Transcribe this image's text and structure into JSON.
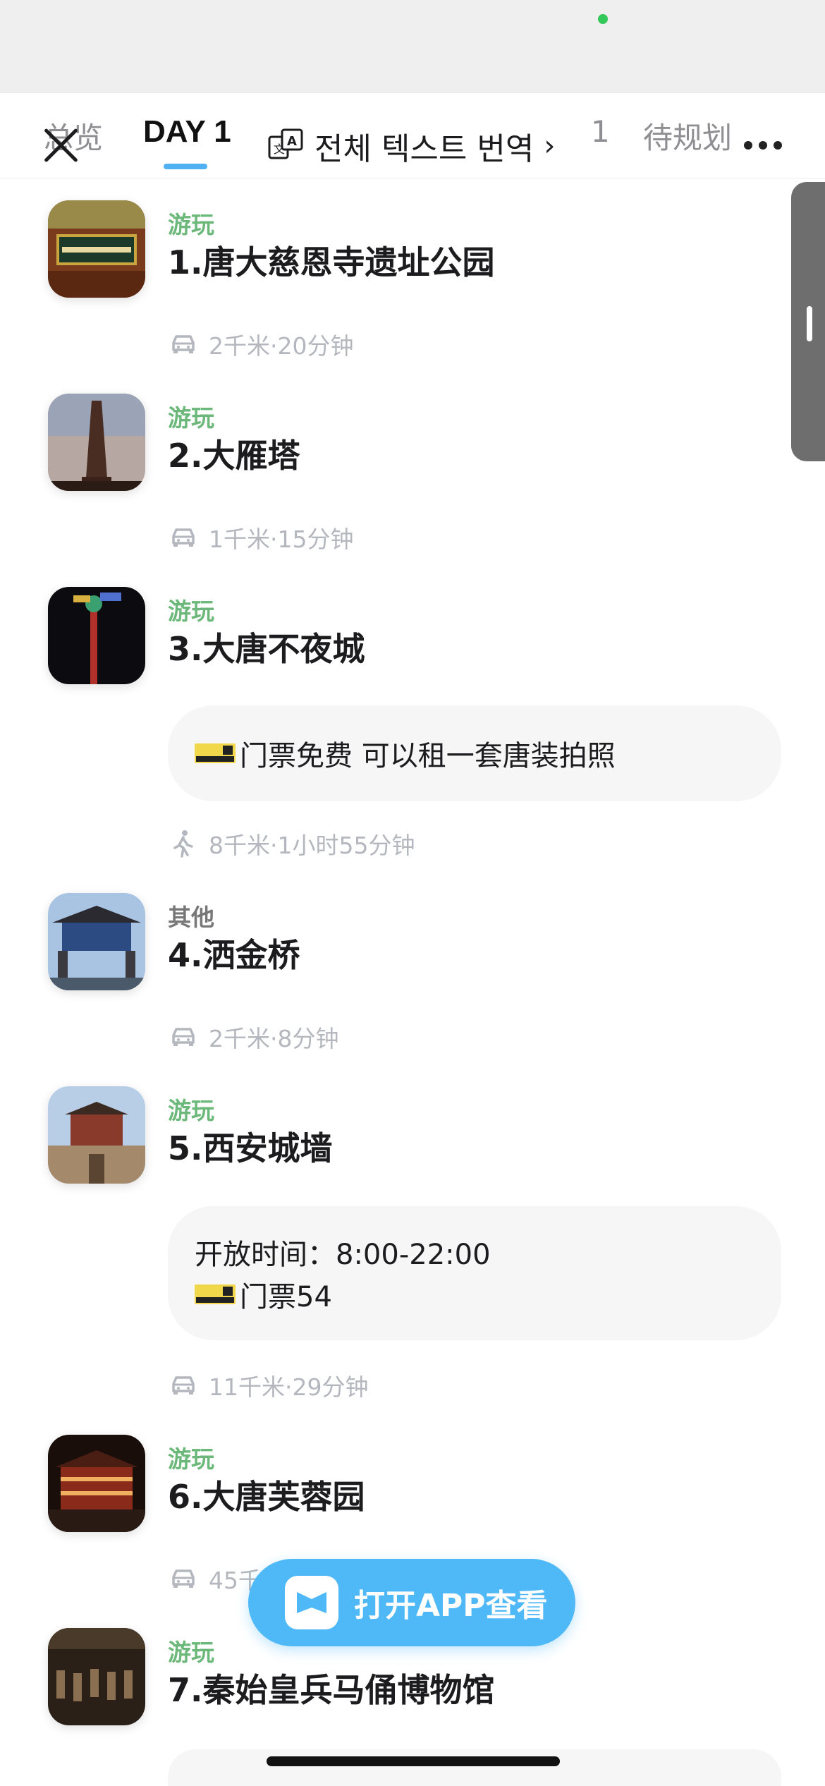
{
  "colors": {
    "accent": "#4fb0f2",
    "category_play": "#6cb87a",
    "transit_text": "#b4b8be",
    "open_app_bg": "#4fb8f7"
  },
  "tabs": {
    "overview": "总览",
    "day1": "DAY 1",
    "partial": "1",
    "todo": "待规划"
  },
  "translate": {
    "label": "전체 텍스트 번역",
    "chevron": "›"
  },
  "itinerary": [
    {
      "category": "游玩",
      "name": "1.唐大慈恩寺遗址公园",
      "icon": "landmark-photo"
    },
    {
      "category": "游玩",
      "name": "2.大雁塔",
      "icon": "pagoda-photo"
    },
    {
      "category": "游玩",
      "name": "3.大唐不夜城",
      "icon": "night-city-photo"
    },
    {
      "category": "其他",
      "name": "4.洒金桥",
      "icon": "gate-photo"
    },
    {
      "category": "游玩",
      "name": "5.西安城墙",
      "icon": "city-wall-photo"
    },
    {
      "category": "游玩",
      "name": "6.大唐芙蓉园",
      "icon": "palace-night-photo"
    },
    {
      "category": "游玩",
      "name": "7.秦始皇兵马俑博物馆",
      "icon": "terracotta-photo"
    }
  ],
  "transits": [
    {
      "mode": "car-icon",
      "text": "2千米·20分钟"
    },
    {
      "mode": "car-icon",
      "text": "1千米·15分钟"
    },
    {
      "mode": "walk-icon",
      "text": "8千米·1小时55分钟"
    },
    {
      "mode": "car-icon",
      "text": "2千米·8分钟"
    },
    {
      "mode": "car-icon",
      "text": "11千米·29分钟"
    },
    {
      "mode": "car-icon",
      "text": "45千"
    }
  ],
  "notes": {
    "n3": {
      "line1": "门票免费 可以租一套唐装拍照"
    },
    "n5": {
      "line1": "开放时间：8:00-22:00",
      "line2": "门票54"
    }
  },
  "open_app": {
    "label": "打开APP查看"
  }
}
